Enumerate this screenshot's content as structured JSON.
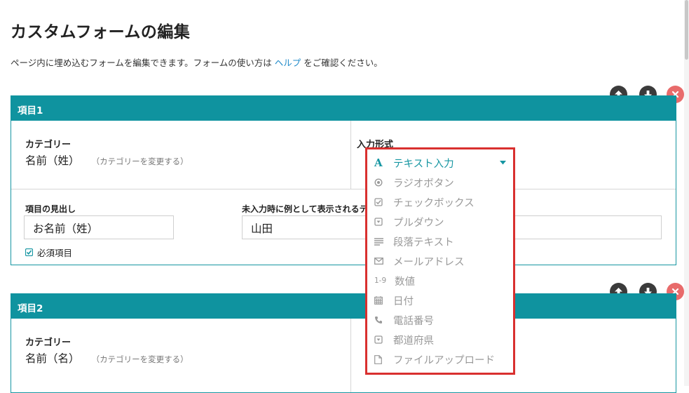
{
  "page": {
    "title": "カスタムフォームの編集",
    "intro_before": "ページ内に埋め込むフォームを編集できます。フォームの使い方は",
    "intro_link": "ヘルプ",
    "intro_after": "をご確認ください。"
  },
  "items": [
    {
      "header": "項目1",
      "category_label": "カテゴリー",
      "category_value": "名前（姓）",
      "category_change": "（カテゴリーを変更する）",
      "input_type_label": "入力形式",
      "heading_label": "項目の見出し",
      "heading_value": "お名前（姓）",
      "placeholder_label": "未入力時に例として表示されるテ",
      "placeholder_value": "山田",
      "required_label": "必須項目"
    },
    {
      "header": "項目2",
      "category_label": "カテゴリー",
      "category_value": "名前（名）",
      "category_change": "（カテゴリーを変更する）"
    }
  ],
  "dropdown": {
    "selected": "テキスト入力",
    "options": [
      {
        "label": "ラジオボタン",
        "icon": "radio-icon"
      },
      {
        "label": "チェックボックス",
        "icon": "checkbox-icon"
      },
      {
        "label": "プルダウン",
        "icon": "pulldown-icon"
      },
      {
        "label": "段落テキスト",
        "icon": "paragraph-icon"
      },
      {
        "label": "メールアドレス",
        "icon": "mail-icon"
      },
      {
        "label": "数値",
        "icon": "number-icon",
        "icon_text": "1-9"
      },
      {
        "label": "日付",
        "icon": "calendar-icon"
      },
      {
        "label": "電話番号",
        "icon": "phone-icon"
      },
      {
        "label": "都道府県",
        "icon": "prefecture-icon"
      },
      {
        "label": "ファイルアップロード",
        "icon": "file-icon"
      }
    ],
    "selected_icon_text": "A"
  },
  "colors": {
    "accent": "#0f939f",
    "active_text": "#1696a2",
    "highlight_border": "#d9302f",
    "delete": "#e86b6b"
  }
}
